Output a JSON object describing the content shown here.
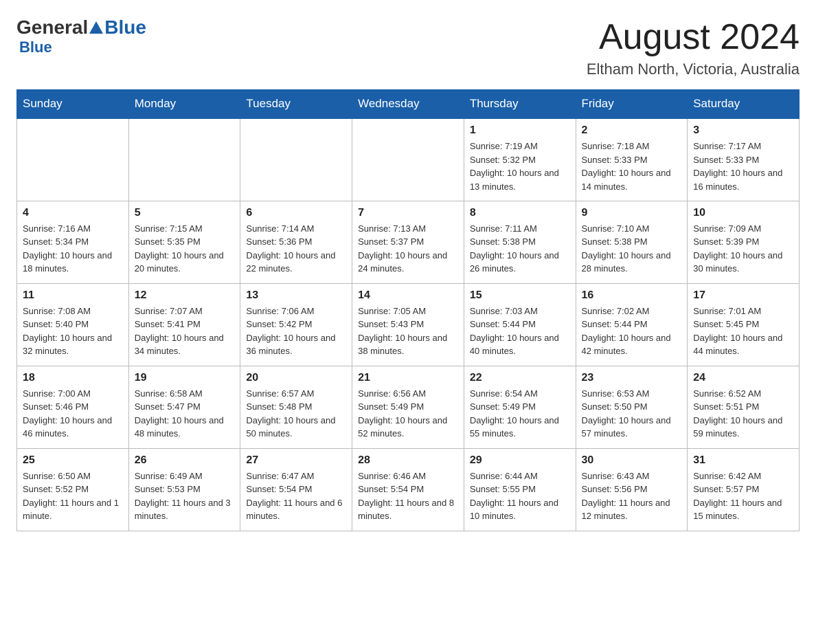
{
  "header": {
    "logo_general": "General",
    "logo_blue": "Blue",
    "title": "August 2024",
    "subtitle": "Eltham North, Victoria, Australia"
  },
  "days_of_week": [
    "Sunday",
    "Monday",
    "Tuesday",
    "Wednesday",
    "Thursday",
    "Friday",
    "Saturday"
  ],
  "weeks": [
    [
      {
        "day": "",
        "info": ""
      },
      {
        "day": "",
        "info": ""
      },
      {
        "day": "",
        "info": ""
      },
      {
        "day": "",
        "info": ""
      },
      {
        "day": "1",
        "info": "Sunrise: 7:19 AM\nSunset: 5:32 PM\nDaylight: 10 hours and 13 minutes."
      },
      {
        "day": "2",
        "info": "Sunrise: 7:18 AM\nSunset: 5:33 PM\nDaylight: 10 hours and 14 minutes."
      },
      {
        "day": "3",
        "info": "Sunrise: 7:17 AM\nSunset: 5:33 PM\nDaylight: 10 hours and 16 minutes."
      }
    ],
    [
      {
        "day": "4",
        "info": "Sunrise: 7:16 AM\nSunset: 5:34 PM\nDaylight: 10 hours and 18 minutes."
      },
      {
        "day": "5",
        "info": "Sunrise: 7:15 AM\nSunset: 5:35 PM\nDaylight: 10 hours and 20 minutes."
      },
      {
        "day": "6",
        "info": "Sunrise: 7:14 AM\nSunset: 5:36 PM\nDaylight: 10 hours and 22 minutes."
      },
      {
        "day": "7",
        "info": "Sunrise: 7:13 AM\nSunset: 5:37 PM\nDaylight: 10 hours and 24 minutes."
      },
      {
        "day": "8",
        "info": "Sunrise: 7:11 AM\nSunset: 5:38 PM\nDaylight: 10 hours and 26 minutes."
      },
      {
        "day": "9",
        "info": "Sunrise: 7:10 AM\nSunset: 5:38 PM\nDaylight: 10 hours and 28 minutes."
      },
      {
        "day": "10",
        "info": "Sunrise: 7:09 AM\nSunset: 5:39 PM\nDaylight: 10 hours and 30 minutes."
      }
    ],
    [
      {
        "day": "11",
        "info": "Sunrise: 7:08 AM\nSunset: 5:40 PM\nDaylight: 10 hours and 32 minutes."
      },
      {
        "day": "12",
        "info": "Sunrise: 7:07 AM\nSunset: 5:41 PM\nDaylight: 10 hours and 34 minutes."
      },
      {
        "day": "13",
        "info": "Sunrise: 7:06 AM\nSunset: 5:42 PM\nDaylight: 10 hours and 36 minutes."
      },
      {
        "day": "14",
        "info": "Sunrise: 7:05 AM\nSunset: 5:43 PM\nDaylight: 10 hours and 38 minutes."
      },
      {
        "day": "15",
        "info": "Sunrise: 7:03 AM\nSunset: 5:44 PM\nDaylight: 10 hours and 40 minutes."
      },
      {
        "day": "16",
        "info": "Sunrise: 7:02 AM\nSunset: 5:44 PM\nDaylight: 10 hours and 42 minutes."
      },
      {
        "day": "17",
        "info": "Sunrise: 7:01 AM\nSunset: 5:45 PM\nDaylight: 10 hours and 44 minutes."
      }
    ],
    [
      {
        "day": "18",
        "info": "Sunrise: 7:00 AM\nSunset: 5:46 PM\nDaylight: 10 hours and 46 minutes."
      },
      {
        "day": "19",
        "info": "Sunrise: 6:58 AM\nSunset: 5:47 PM\nDaylight: 10 hours and 48 minutes."
      },
      {
        "day": "20",
        "info": "Sunrise: 6:57 AM\nSunset: 5:48 PM\nDaylight: 10 hours and 50 minutes."
      },
      {
        "day": "21",
        "info": "Sunrise: 6:56 AM\nSunset: 5:49 PM\nDaylight: 10 hours and 52 minutes."
      },
      {
        "day": "22",
        "info": "Sunrise: 6:54 AM\nSunset: 5:49 PM\nDaylight: 10 hours and 55 minutes."
      },
      {
        "day": "23",
        "info": "Sunrise: 6:53 AM\nSunset: 5:50 PM\nDaylight: 10 hours and 57 minutes."
      },
      {
        "day": "24",
        "info": "Sunrise: 6:52 AM\nSunset: 5:51 PM\nDaylight: 10 hours and 59 minutes."
      }
    ],
    [
      {
        "day": "25",
        "info": "Sunrise: 6:50 AM\nSunset: 5:52 PM\nDaylight: 11 hours and 1 minute."
      },
      {
        "day": "26",
        "info": "Sunrise: 6:49 AM\nSunset: 5:53 PM\nDaylight: 11 hours and 3 minutes."
      },
      {
        "day": "27",
        "info": "Sunrise: 6:47 AM\nSunset: 5:54 PM\nDaylight: 11 hours and 6 minutes."
      },
      {
        "day": "28",
        "info": "Sunrise: 6:46 AM\nSunset: 5:54 PM\nDaylight: 11 hours and 8 minutes."
      },
      {
        "day": "29",
        "info": "Sunrise: 6:44 AM\nSunset: 5:55 PM\nDaylight: 11 hours and 10 minutes."
      },
      {
        "day": "30",
        "info": "Sunrise: 6:43 AM\nSunset: 5:56 PM\nDaylight: 11 hours and 12 minutes."
      },
      {
        "day": "31",
        "info": "Sunrise: 6:42 AM\nSunset: 5:57 PM\nDaylight: 11 hours and 15 minutes."
      }
    ]
  ]
}
